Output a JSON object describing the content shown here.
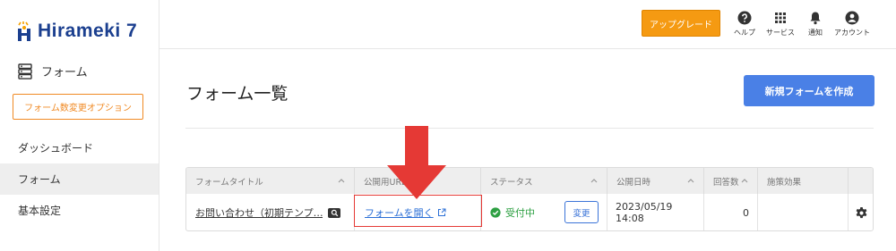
{
  "brand": {
    "name": "Hirameki 7",
    "text_color": "#1b3f8f",
    "accent_color": "#f5a000"
  },
  "sidebar": {
    "section_icon": "server-stack-icon",
    "section_label": "フォーム",
    "option_button": "フォーム数変更オプション",
    "items": [
      {
        "label": "ダッシュボード",
        "active": false
      },
      {
        "label": "フォーム",
        "active": true
      },
      {
        "label": "基本設定",
        "active": false
      }
    ]
  },
  "header": {
    "upgrade_label": "アップグレード",
    "upgrade_color": "#f59a12",
    "items": [
      {
        "icon": "help-icon",
        "label": "ヘルプ"
      },
      {
        "icon": "grid-icon",
        "label": "サービス"
      },
      {
        "icon": "bell-icon",
        "label": "通知"
      },
      {
        "icon": "account-icon",
        "label": "アカウント"
      }
    ]
  },
  "main": {
    "title": "フォーム一覧",
    "new_button": "新規フォームを作成",
    "new_button_color": "#4a80e6"
  },
  "table": {
    "columns": [
      "フォームタイトル",
      "公開用URL",
      "ステータス",
      "公開日時",
      "回答数",
      "施策効果",
      ""
    ],
    "rows": [
      {
        "title": "お問い合わせ（初期テンプ…",
        "url_label": "フォームを開く",
        "status": "受付中",
        "change_label": "変更",
        "published": "2023/05/19 14:08",
        "responses": "0",
        "effect": ""
      }
    ]
  },
  "annotation": {
    "color": "#e53935"
  }
}
